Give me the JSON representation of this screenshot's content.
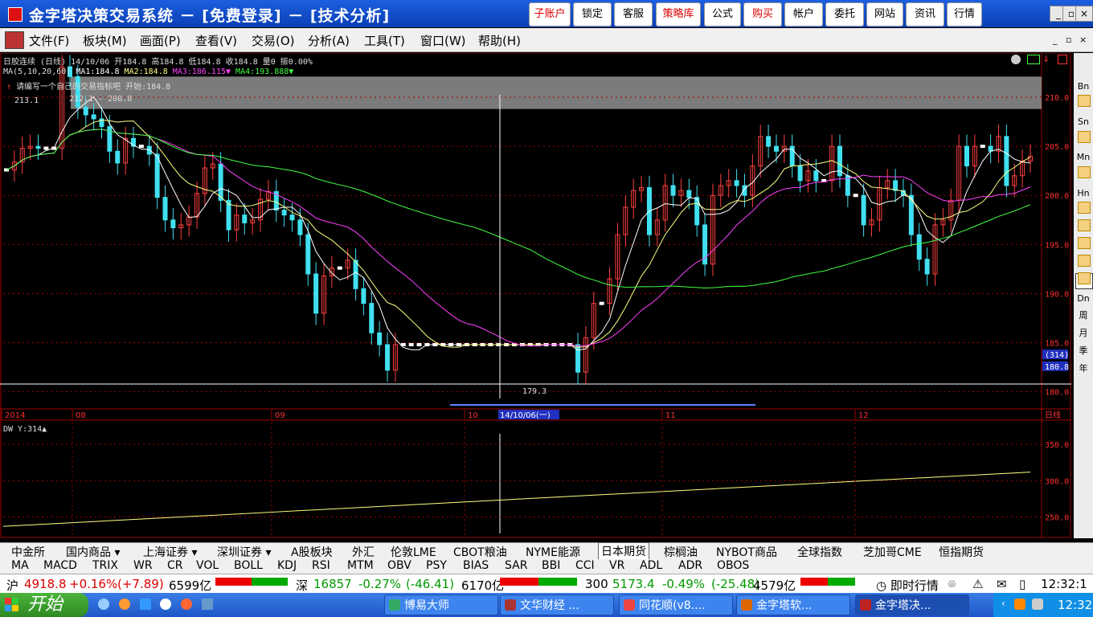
{
  "window": {
    "title": "金字塔决策交易系统 － [免费登录] － [技术分析]",
    "toolbar_buttons": [
      {
        "label": "子账户",
        "red": true
      },
      {
        "label": "锁定",
        "red": false
      },
      {
        "label": "客服",
        "red": false
      },
      {
        "label": "策略库",
        "red": true
      },
      {
        "label": "公式",
        "red": false
      },
      {
        "label": "购买",
        "red": true
      },
      {
        "label": "帐户",
        "red": false
      },
      {
        "label": "委托",
        "red": false
      },
      {
        "label": "网站",
        "red": false
      },
      {
        "label": "资讯",
        "red": false
      },
      {
        "label": "行情",
        "red": false
      }
    ],
    "controls": [
      "_",
      "▫",
      "×"
    ]
  },
  "menu": [
    "文件(F)",
    "板块(M)",
    "画面(P)",
    "查看(V)",
    "交易(O)",
    "分析(A)",
    "工具(T)",
    "窗口(W)",
    "帮助(H)"
  ],
  "info": {
    "line1": "日胶连续 (日线) 14/10/06 开184.8 高184.8 低184.8 收184.8 量0 振0.00%",
    "ma_prefix": "MA(5,10,20,60)",
    "ma1": "MA1:184.8",
    "ma2": "MA2:184.8",
    "ma3": "MA3:186.115▼",
    "ma4": "MA4:193.888▼",
    "line3": "请编写一个自己的交易指标吧 开始:184.8",
    "hi_label": "213.1",
    "range_label": "212.1 - 208.8",
    "lo_label": "179.3",
    "lower_indicator": "DW Y:314▲"
  },
  "colors": {
    "up": "#ff4040",
    "down": "#40e0f0",
    "ma1": "#ffffff",
    "ma2": "#ffff80",
    "ma3": "#ff40ff",
    "ma4": "#40ff40",
    "grid": "#a00000",
    "axis": "#ff3030"
  },
  "chart_data": {
    "type": "candlestick",
    "symbol": "日胶连续",
    "period": "日线",
    "y_ticks": [
      180.0,
      185.0,
      190.0,
      195.0,
      200.0,
      205.0,
      210.0
    ],
    "ylim": [
      178.5,
      214.5
    ],
    "x_labels": [
      "2014",
      "08",
      "09",
      "10",
      "14/10/06(一)",
      "11",
      "12",
      "日线"
    ],
    "price_tags": [
      "(314)",
      "180.8"
    ],
    "closes": [
      202.6,
      203.4,
      204.8,
      205.0,
      204.8,
      204.8,
      204.8,
      213.1,
      212.1,
      209.0,
      208.2,
      207.8,
      207.0,
      204.5,
      203.3,
      205.8,
      205.0,
      205.0,
      204.2,
      199.8,
      197.5,
      196.7,
      197.0,
      197.8,
      200.2,
      202.8,
      203.2,
      199.5,
      196.5,
      198.0,
      197.2,
      197.5,
      199.6,
      200.4,
      198.5,
      198.0,
      197.5,
      196.0,
      192.0,
      188.0,
      191.8,
      192.6,
      192.6,
      193.4,
      190.5,
      189.0,
      186.0,
      184.8,
      182.2,
      184.8,
      184.8,
      184.8,
      184.8,
      184.8,
      184.8,
      184.8,
      184.8,
      184.8,
      184.8,
      184.8,
      184.8,
      184.8,
      184.8,
      184.8,
      184.8,
      184.8,
      184.8,
      184.8,
      184.8,
      184.8,
      184.8,
      184.8,
      182.0,
      185.5,
      189.0,
      189.0,
      191.5,
      196.0,
      198.8,
      200.5,
      200.8,
      196.0,
      197.5,
      201.0,
      200.0,
      200.5,
      199.8,
      197.0,
      193.0,
      200.0,
      201.0,
      201.5,
      201.0,
      200.0,
      203.0,
      206.0,
      205.0,
      204.5,
      205.0,
      203.0,
      201.5,
      202.5,
      201.5,
      201.5,
      205.0,
      202.0,
      200.0,
      200.0,
      197.0,
      197.5,
      200.8,
      201.5,
      200.5,
      200.0,
      196.0,
      193.5,
      192.0,
      197.0,
      197.5,
      199.5,
      205.0,
      203.0,
      205.0,
      205.0,
      204.5,
      206.0,
      201.0,
      202.0,
      203.5,
      204.0
    ],
    "highs_lows_note": "wicks approximate",
    "lower_panel": {
      "name": "DW",
      "y_ticks": [
        250.0,
        300.0,
        350.0
      ],
      "start": 237,
      "end": 314
    }
  },
  "right_toolbar": [
    "Bn",
    "Sn",
    "Mn",
    "Hn",
    "日",
    "Dn",
    "周",
    "月",
    "季",
    "年"
  ],
  "tabs_row1": [
    {
      "label": "中金所",
      "selected": false
    },
    {
      "label": "国内商品 ▾",
      "selected": false
    },
    {
      "label": "上海证券 ▾",
      "selected": false
    },
    {
      "label": "深圳证券 ▾",
      "selected": false
    },
    {
      "label": "A股板块",
      "selected": false
    },
    {
      "label": "外汇",
      "selected": false
    },
    {
      "label": "伦敦LME",
      "selected": false
    },
    {
      "label": "CBOT粮油",
      "selected": false
    },
    {
      "label": "NYME能源",
      "selected": false
    },
    {
      "label": "日本期货",
      "selected": true
    },
    {
      "label": "棕榈油",
      "selected": false
    },
    {
      "label": "NYBOT商品",
      "selected": false
    },
    {
      "label": "全球指数",
      "selected": false
    },
    {
      "label": "芝加哥CME",
      "selected": false
    },
    {
      "label": "恒指期货",
      "selected": false
    }
  ],
  "indicator_tabs": [
    "MA",
    "MACD",
    "TRIX",
    "WR",
    "CR",
    "VOL",
    "BOLL",
    "KDJ",
    "RSI",
    "MTM",
    "OBV",
    "PSY",
    "BIAS",
    "SAR",
    "BBI",
    "CCI",
    "VR",
    "ADL",
    "ADR",
    "OBOS"
  ],
  "status": {
    "sh_label": "沪",
    "sh_value": "4918.8",
    "sh_pct": "+0.16%",
    "sh_chg": "(+7.89)",
    "sh_amt": "6599亿",
    "sz_label": "深",
    "sz_value": "16857",
    "sz_pct": "-0.27%",
    "sz_chg": "(-46.41)",
    "sz_amt": "6170亿",
    "i300_label": "300",
    "i300_value": "5173.4",
    "i300_pct": "-0.49%",
    "i300_chg": "(-25.48)",
    "i300_amt": "4579亿",
    "realtime": "即时行情",
    "clock": "12:32:1"
  },
  "taskbar": {
    "start": "开始",
    "tasks": [
      {
        "label": "博易大师",
        "active": false
      },
      {
        "label": "文华财经 ...",
        "active": false
      },
      {
        "label": "同花顺(v8....",
        "active": false
      },
      {
        "label": "金字塔软...",
        "active": false
      },
      {
        "label": "金字塔决...",
        "active": true
      }
    ],
    "time": "12:32"
  }
}
